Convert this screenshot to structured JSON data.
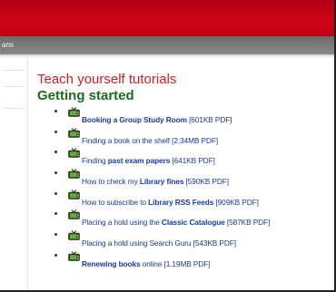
{
  "subbar": {
    "text": "ans"
  },
  "main": {
    "title": "Teach yourself tutorials",
    "subtitle": "Getting started"
  },
  "tutorials": [
    {
      "pre": "",
      "bold": "Booking a Group Study Room",
      "post": " [601KB PDF]"
    },
    {
      "pre": "Finding a book on the shelf [2.34MB PDF]",
      "bold": "",
      "post": ""
    },
    {
      "pre": "Finding ",
      "bold": "past exam papers",
      "post": " [641KB PDF]"
    },
    {
      "pre": "How to check my ",
      "bold": "Library fines",
      "post": " [590KB PDF]"
    },
    {
      "pre": "How to subscribe to ",
      "bold": "Library RSS Feeds",
      "post": " [909KB PDF]"
    },
    {
      "pre": "Placing a hold using the ",
      "bold": "Classic Catalogue",
      "post": " [587KB PDF]"
    },
    {
      "pre": "Placing a hold using Search Guru [543KB PDF]",
      "bold": "",
      "post": ""
    },
    {
      "pre": "",
      "bold": "Renewing books",
      "post": " online [1.19MB PDF]"
    }
  ],
  "colors": {
    "header_red": "#cf0519",
    "subbar_gray": "#7a7a7a",
    "title_red": "#cc1f28",
    "subtitle_green": "#1d6b1f",
    "link_blue": "#1a3a9a"
  },
  "icons": {
    "tutorial": "tv-icon",
    "bullet": "bullet-icon"
  }
}
